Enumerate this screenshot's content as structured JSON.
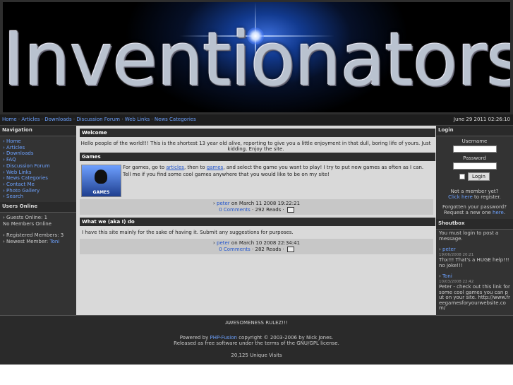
{
  "banner": {
    "logo_text": "Inventionators"
  },
  "nav": {
    "links": [
      "Home",
      "Articles",
      "Downloads",
      "Discussion Forum",
      "Web Links",
      "News Categories"
    ],
    "separator": "·",
    "date": "June 29 2011 02:26:10"
  },
  "left": {
    "navigation_title": "Navigation",
    "navigation_items": [
      "Home",
      "Articles",
      "Downloads",
      "FAQ",
      "Discussion Forum",
      "Web Links",
      "News Categories",
      "Contact Me",
      "Photo Gallery",
      "Search"
    ],
    "users_title": "Users Online",
    "guests": "Guests Online: 1",
    "members_online": "No Members Online",
    "registered": "Registered Members: 3",
    "newest_label": "Newest Member: ",
    "newest_member": "Toni"
  },
  "center": {
    "welcome_title": "Welcome",
    "welcome_text": "Hello people of the world!!! This is the shortest 13 year old alive, reporting to give you a little enjoyment in that dull, boring life of yours. Just kidding. Enjoy the site.",
    "games_title": "Games",
    "games_img_label": "GAMES",
    "games_text_1": "For games, go to ",
    "games_link_1": "articles",
    "games_text_2": ", then to ",
    "games_link_2": "games",
    "games_text_3": ", and select the game you want to play! I try to put new games as often as I can. Tell me if you find some cool games anywhere that you would like to be on my site!",
    "games_author": "peter",
    "games_date": " on March 11 2008 19:22:21",
    "games_comments": "0 Comments",
    "games_reads": " · 292 Reads ·",
    "what_title": "What we (aka I) do",
    "what_text": "I have this site mainly for the sake of having it. Submit any suggestions for purposes.",
    "what_author": "peter",
    "what_date": " on March 10 2008 22:34:41",
    "what_comments": "0 Comments",
    "what_reads": " · 282 Reads ·"
  },
  "right": {
    "login_title": "Login",
    "username_label": "Username",
    "password_label": "Password",
    "login_button": "Login",
    "not_member": "Not a member yet?",
    "click_here": "Click here",
    "to_register": " to register.",
    "forgotten": "Forgotten your password?",
    "request_new": "Request a new one ",
    "here": "here",
    "shoutbox_title": "Shoutbox",
    "shoutbox_notice": "You must login to post a message.",
    "shout1_user": "peter",
    "shout1_date": "19/06/2008 20:21",
    "shout1_text": "Thx!!! That's a HUGE help!!! no joke!!!",
    "shout2_user": "Toni",
    "shout2_date": "10/03/2008 22:42",
    "shout2_text": "Peter - check out this link for some cool games you can put on your site. http://www.freegamesforyourwebsite.com/"
  },
  "footer": {
    "tagline": "AWESOMENESS RULEZ!!!",
    "powered_by": "Powered by ",
    "php_fusion": "PHP-Fusion",
    "copyright": " copyright © 2003-2006 by Nick Jones.",
    "license": "Released as free software under the terms of the GNU/GPL license.",
    "visits": "20,125 Unique Visits"
  }
}
